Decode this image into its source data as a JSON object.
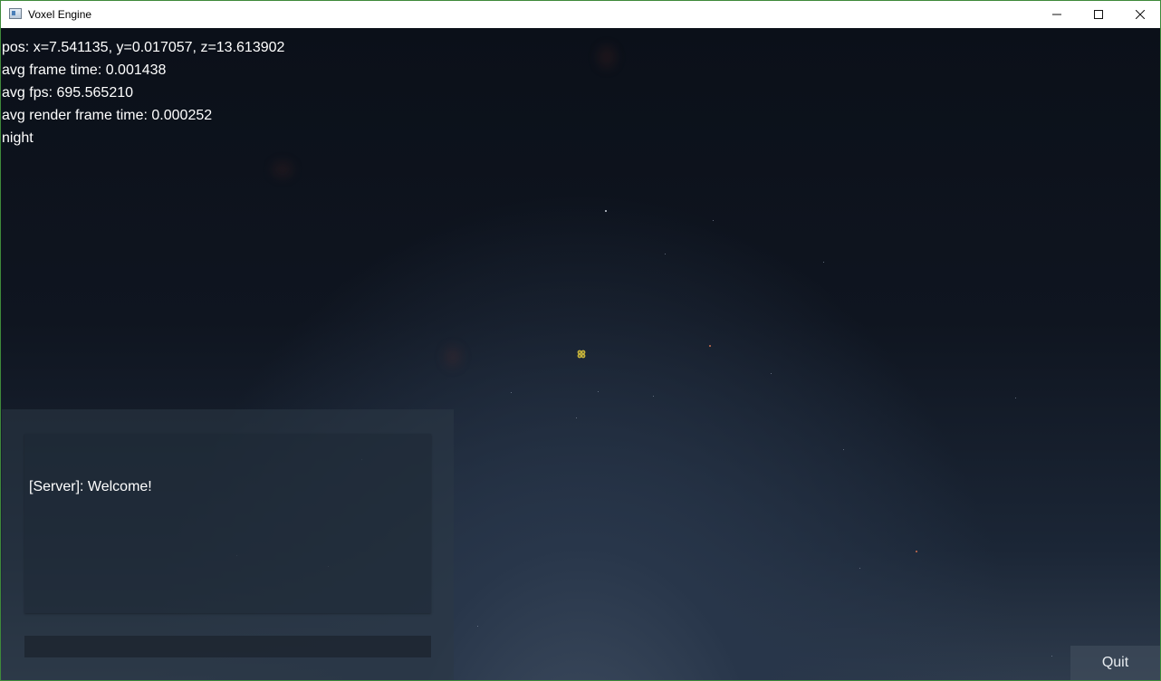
{
  "window": {
    "title": "Voxel Engine",
    "controls": [
      "minimize",
      "maximize",
      "close"
    ]
  },
  "debug": {
    "pos": "pos: x=7.541135, y=0.017057, z=13.613902",
    "frame_time": "avg frame time: 0.001438",
    "fps": "avg fps: 695.565210",
    "render_time": "avg render frame time: 0.000252",
    "time_of_day": "night"
  },
  "chat": {
    "messages": [
      "[Server]: Welcome!"
    ],
    "input_value": ""
  },
  "buttons": {
    "quit": "Quit"
  },
  "colors": {
    "sky_top": "#0b1019",
    "sky_horizon": "#2e3b4c",
    "crosshair": "#c9b53a",
    "window_border": "#3f8a3a"
  }
}
